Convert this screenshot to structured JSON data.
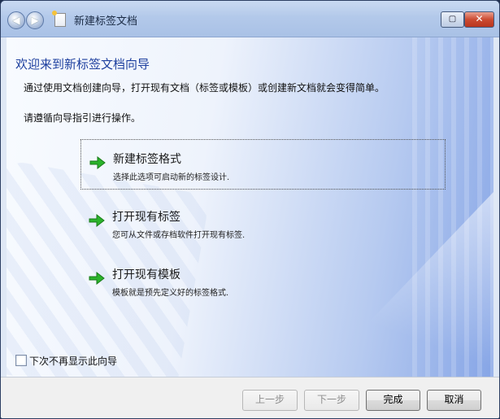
{
  "window": {
    "title": "新建标签文档",
    "nav_back_glyph": "◀",
    "nav_forward_glyph": "▶",
    "restore_glyph": "▢",
    "close_glyph": "✕"
  },
  "wizard": {
    "heading": "欢迎来到新标签文档向导",
    "intro": "通过使用文档创建向导，打开现有文档（标签或模板）或创建新文档就会变得简单。",
    "instruction": "请遵循向导指引进行操作。",
    "options": [
      {
        "title": "新建标签格式",
        "description": "选择此选项可启动新的标签设计.",
        "selected": true,
        "icon": "green-arrow-icon"
      },
      {
        "title": "打开现有标签",
        "description": "您可从文件或存档软件打开现有标签.",
        "selected": false,
        "icon": "green-arrow-icon"
      },
      {
        "title": "打开现有模板",
        "description": "模板就是预先定义好的标签格式.",
        "selected": false,
        "icon": "green-arrow-icon"
      }
    ],
    "dont_show_label": "下次不再显示此向导",
    "dont_show_checked": false
  },
  "buttons": {
    "prev": "上一步",
    "next": "下一步",
    "finish": "完成",
    "cancel": "取消"
  },
  "colors": {
    "heading": "#1d3f9e",
    "arrow": "#2bb32b"
  }
}
